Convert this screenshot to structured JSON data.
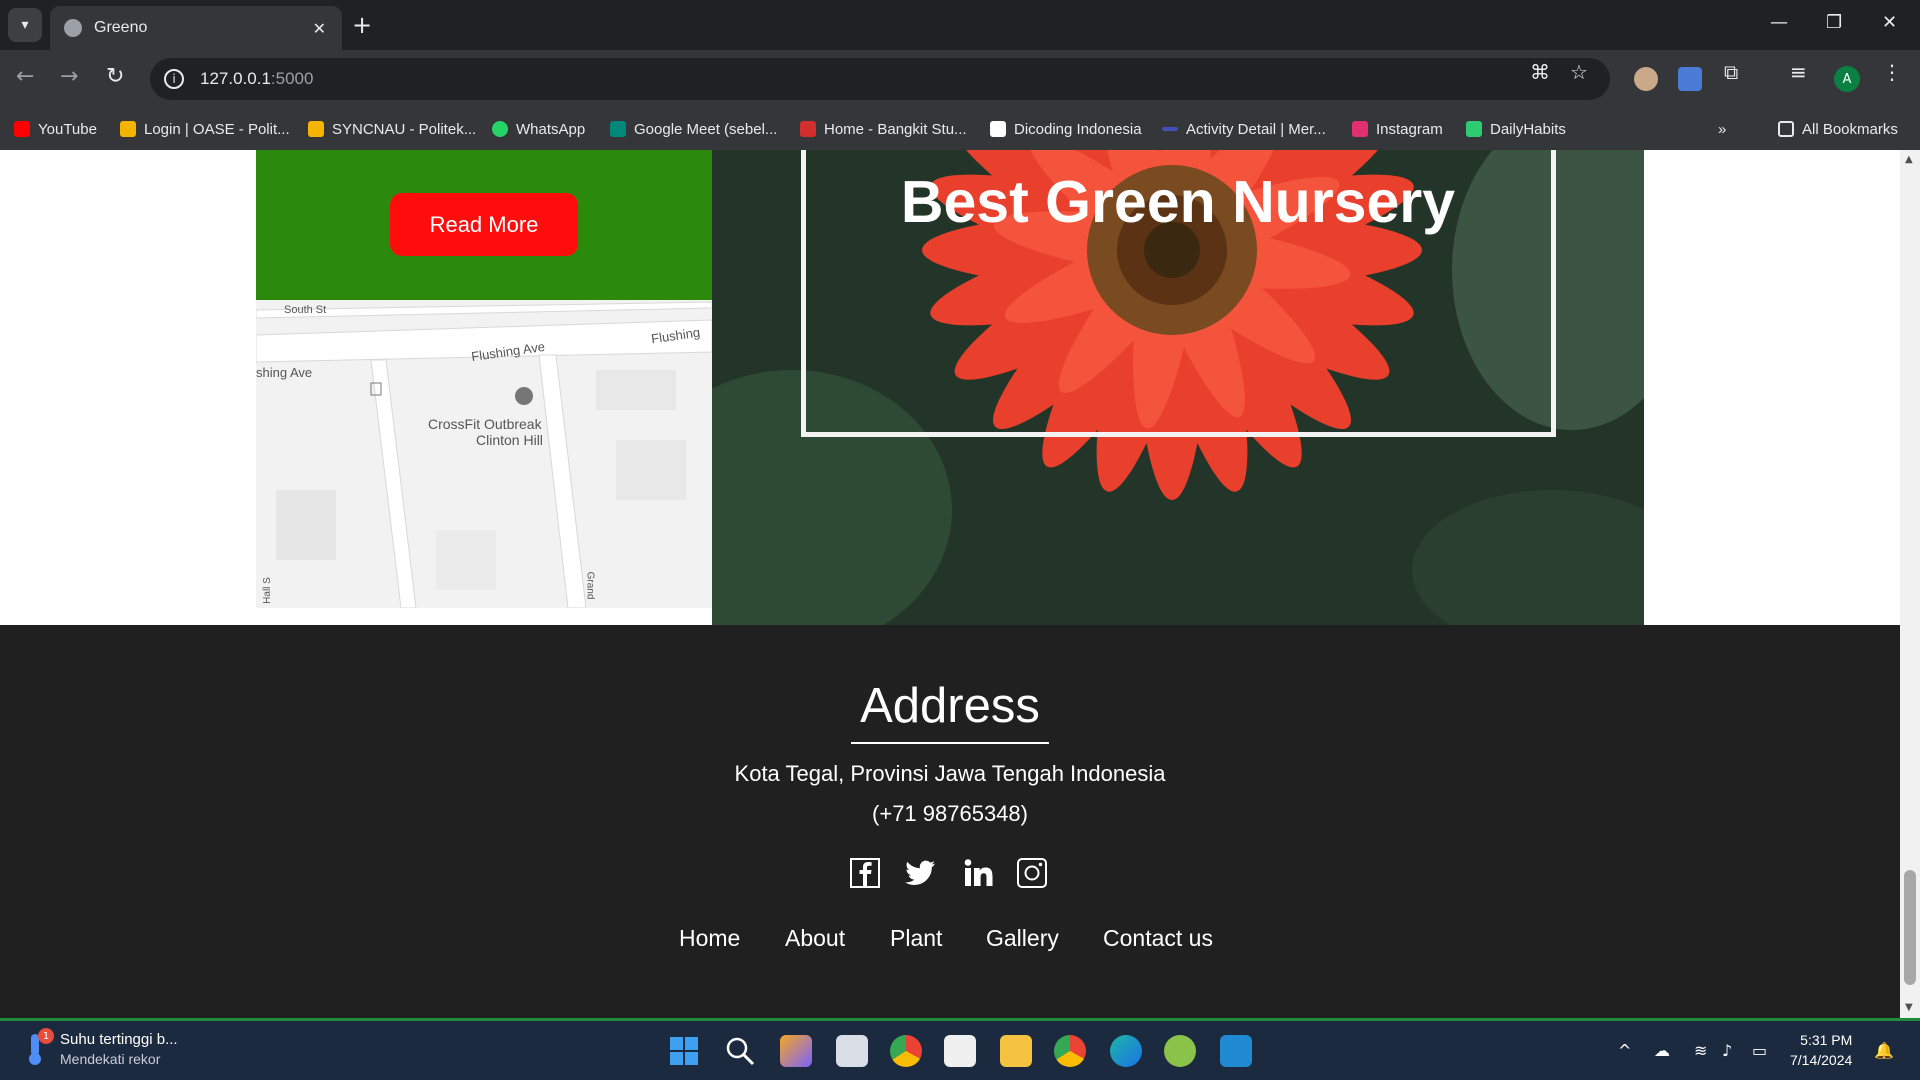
{
  "browser": {
    "tab_title": "Greeno",
    "url_host": "127.0.0.1",
    "url_port": ":5000"
  },
  "bookmarks": [
    {
      "label": "YouTube",
      "color": "#ff0000"
    },
    {
      "label": "Login | OASE - Polit...",
      "color": "#f4b400"
    },
    {
      "label": "SYNCNAU - Politek...",
      "color": "#f4b400"
    },
    {
      "label": "WhatsApp",
      "color": "#25d366"
    },
    {
      "label": "Google Meet (sebel...",
      "color": "#00897b"
    },
    {
      "label": "Home - Bangkit Stu...",
      "color": "#d32f2f"
    },
    {
      "label": "Dicoding Indonesia",
      "color": "#ffffff"
    },
    {
      "label": "Activity Detail | Mer...",
      "color": "#3f51b5"
    },
    {
      "label": "Instagram",
      "color": "#e1306c"
    },
    {
      "label": "DailyHabits",
      "color": "#2ecc71"
    }
  ],
  "all_bookmarks": "All Bookmarks",
  "hero": {
    "read_more": "Read More",
    "title": "Best Green Nursery"
  },
  "map": {
    "labels": [
      "South St",
      "Flushing Ave",
      "Flushing",
      "shing Ave",
      "CrossFit Outbreak",
      "Clinton Hill",
      "Grand",
      "Hall S"
    ]
  },
  "footer": {
    "address_title": "Address",
    "address": "Kota Tegal, Provinsi Jawa Tengah Indonesia",
    "phone": "(+71 98765348)",
    "social": [
      "facebook-icon",
      "twitter-icon",
      "linkedin-icon",
      "instagram-icon"
    ],
    "nav": [
      "Home",
      "About",
      "Plant",
      "Gallery",
      "Contact us"
    ]
  },
  "taskbar": {
    "weather_title": "Suhu tertinggi b...",
    "weather_sub": "Mendekati rekor",
    "weather_badge": "1",
    "time": "5:31 PM",
    "date": "7/14/2024"
  },
  "colors": {
    "green_box": "#2b8a0b",
    "read_more": "#ff0d0d",
    "footer_bg": "#202020"
  }
}
